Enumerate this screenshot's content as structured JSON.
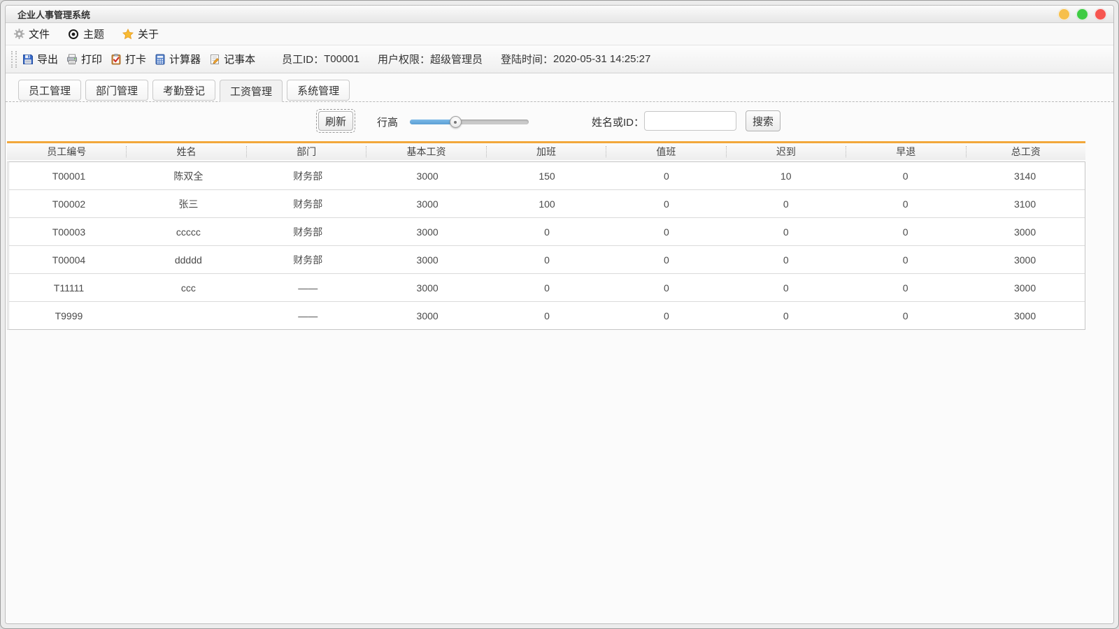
{
  "window": {
    "title": "企业人事管理系统",
    "traffic_lights": [
      "#f6bf4b",
      "#3ecb43",
      "#f6554f"
    ]
  },
  "menu": {
    "items": [
      {
        "label": "文件",
        "icon": "gear-icon"
      },
      {
        "label": "主题",
        "icon": "eye-icon"
      },
      {
        "label": "关于",
        "icon": "star-icon"
      }
    ]
  },
  "toolbar": {
    "buttons": [
      {
        "label": "导出",
        "icon": "save-icon"
      },
      {
        "label": "打印",
        "icon": "printer-icon"
      },
      {
        "label": "打卡",
        "icon": "clock-in-icon"
      },
      {
        "label": "计算器",
        "icon": "calculator-icon"
      },
      {
        "label": "记事本",
        "icon": "notepad-icon"
      }
    ],
    "employee_id_label": "员工ID：",
    "employee_id": "T00001",
    "permission_label": "用户权限：",
    "permission": "超级管理员",
    "login_time_label": "登陆时间：",
    "login_time": "2020-05-31 14:25:27"
  },
  "tabs": [
    {
      "label": "员工管理",
      "active": false
    },
    {
      "label": "部门管理",
      "active": false
    },
    {
      "label": "考勤登记",
      "active": false
    },
    {
      "label": "工资管理",
      "active": true
    },
    {
      "label": "系统管理",
      "active": false
    }
  ],
  "controls": {
    "refresh_label": "刷新",
    "row_height_label": "行高",
    "slider_percent": 38,
    "search_label": "姓名或ID：",
    "search_value": "",
    "search_placeholder": "",
    "search_button_label": "搜索"
  },
  "table": {
    "header_accent_color": "#f2a83b",
    "columns": [
      "员工编号",
      "姓名",
      "部门",
      "基本工资",
      "加班",
      "值班",
      "迟到",
      "早退",
      "总工资"
    ],
    "rows": [
      [
        "T00001",
        "陈双全",
        "财务部",
        "3000",
        "150",
        "0",
        "10",
        "0",
        "3140"
      ],
      [
        "T00002",
        "张三",
        "财务部",
        "3000",
        "100",
        "0",
        "0",
        "0",
        "3100"
      ],
      [
        "T00003",
        "ccccc",
        "财务部",
        "3000",
        "0",
        "0",
        "0",
        "0",
        "3000"
      ],
      [
        "T00004",
        "ddddd",
        "财务部",
        "3000",
        "0",
        "0",
        "0",
        "0",
        "3000"
      ],
      [
        "T11111",
        "ccc",
        "——",
        "3000",
        "0",
        "0",
        "0",
        "0",
        "3000"
      ],
      [
        "T9999",
        "",
        "——",
        "3000",
        "0",
        "0",
        "0",
        "0",
        "3000"
      ]
    ]
  }
}
